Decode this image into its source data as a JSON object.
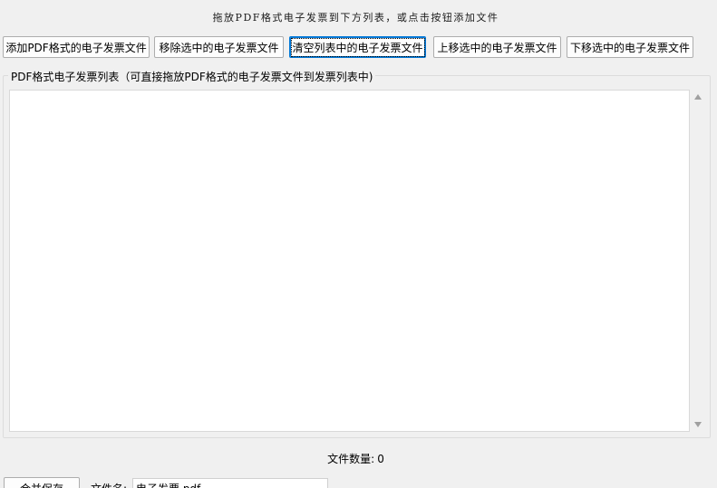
{
  "header": {
    "instruction": "拖放PDF格式电子发票到下方列表，或点击按钮添加文件"
  },
  "toolbar": {
    "add_label": "添加PDF格式的电子发票文件",
    "remove_label": "移除选中的电子发票文件",
    "clear_label": "清空列表中的电子发票文件",
    "move_up_label": "上移选中的电子发票文件",
    "move_down_label": "下移选中的电子发票文件"
  },
  "file_list": {
    "title": "PDF格式电子发票列表（可直接拖放PDF格式的电子发票文件到发票列表中)",
    "items": []
  },
  "status": {
    "count_label": "文件数量:",
    "count_value": "0"
  },
  "footer": {
    "merge_label": "合并保存",
    "filename_label": "文件名:",
    "filename_value": "电子发票.pdf"
  },
  "colors": {
    "window_bg": "#f0f0f0",
    "focus_border": "#0078d7"
  }
}
